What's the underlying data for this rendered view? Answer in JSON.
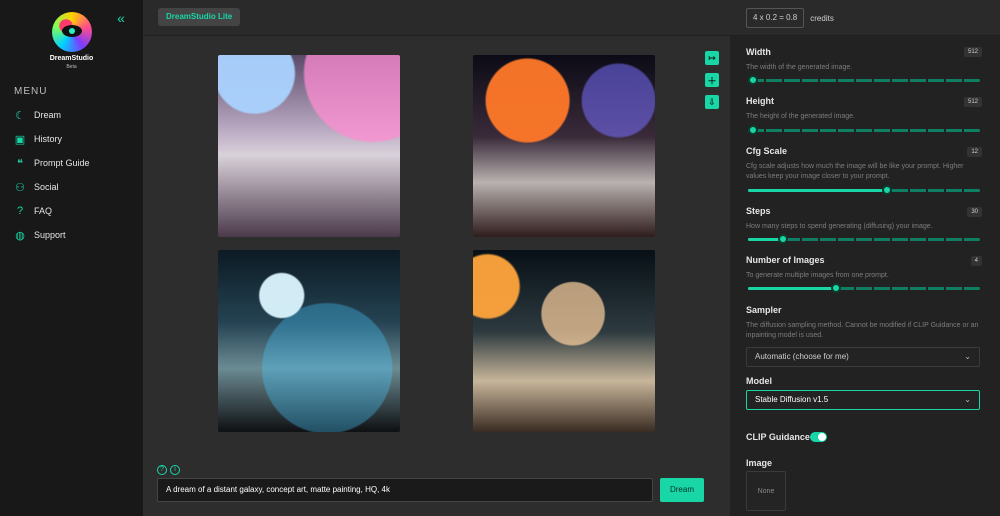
{
  "sidebar": {
    "brand": "DreamStudio",
    "brand_sub": "Beta",
    "menu_title": "MENU",
    "items": [
      {
        "label": "Dream",
        "icon": "dream-icon"
      },
      {
        "label": "History",
        "icon": "history-icon"
      },
      {
        "label": "Prompt Guide",
        "icon": "prompt-guide-icon"
      },
      {
        "label": "Social",
        "icon": "social-icon"
      },
      {
        "label": "FAQ",
        "icon": "faq-icon"
      },
      {
        "label": "Support",
        "icon": "support-icon"
      }
    ]
  },
  "topbar": {
    "tag": "DreamStudio Lite",
    "credits_value": "4 x 0.2 = 0.8",
    "credits_label": "credits"
  },
  "main": {
    "prompt": "A dream of a distant galaxy, concept art, matte painting, HQ, 4k",
    "dream_button": "Dream"
  },
  "panel": {
    "width": {
      "label": "Width",
      "desc": "The width of the generated image.",
      "value": "512",
      "fraction": 0.0
    },
    "height": {
      "label": "Height",
      "desc": "The height of the generated image.",
      "value": "512",
      "fraction": 0.0
    },
    "cfg": {
      "label": "Cfg Scale",
      "desc": "Cfg scale adjusts how much the image will be like your prompt. Higher values keep your image closer to your prompt.",
      "value": "12",
      "fraction": 0.6
    },
    "steps": {
      "label": "Steps",
      "desc": "How many steps to spend generating (diffusing) your image.",
      "value": "30",
      "fraction": 0.15
    },
    "images": {
      "label": "Number of Images",
      "desc": "To generate multiple images from one prompt.",
      "value": "4",
      "fraction": 0.38
    },
    "sampler": {
      "label": "Sampler",
      "desc": "The diffusion sampling method. Cannot be modified if CLIP Guidance or an inpainting model is used.",
      "selected": "Automatic (choose for me)"
    },
    "model": {
      "label": "Model",
      "selected": "Stable Diffusion v1.5"
    },
    "clip": {
      "label": "CLIP Guidance",
      "enabled": true
    },
    "image": {
      "label": "Image",
      "placeholder": "None"
    }
  },
  "colors": {
    "accent": "#19d6a6",
    "panel_bg": "#222222",
    "sidebar_bg": "#181818"
  }
}
